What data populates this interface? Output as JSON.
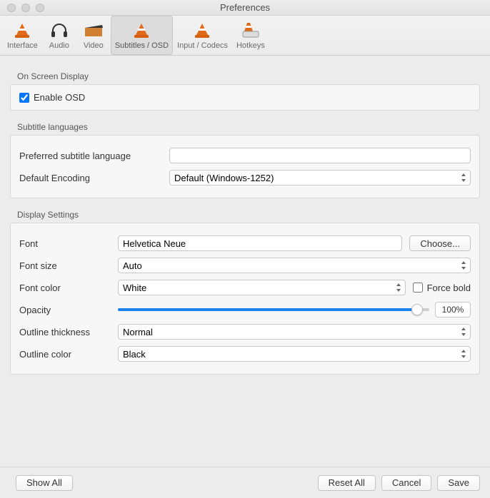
{
  "window": {
    "title": "Preferences"
  },
  "tabs": [
    {
      "label": "Interface"
    },
    {
      "label": "Audio"
    },
    {
      "label": "Video"
    },
    {
      "label": "Subtitles / OSD"
    },
    {
      "label": "Input / Codecs"
    },
    {
      "label": "Hotkeys"
    }
  ],
  "osd": {
    "section": "On Screen Display",
    "enable_label": "Enable OSD"
  },
  "subtitle_lang": {
    "section": "Subtitle languages",
    "preferred_label": "Preferred subtitle language",
    "preferred_value": "",
    "encoding_label": "Default Encoding",
    "encoding_value": "Default (Windows-1252)"
  },
  "display": {
    "section": "Display Settings",
    "font_label": "Font",
    "font_value": "Helvetica Neue",
    "choose_label": "Choose...",
    "font_size_label": "Font size",
    "font_size_value": "Auto",
    "font_color_label": "Font color",
    "font_color_value": "White",
    "force_bold_label": "Force bold",
    "opacity_label": "Opacity",
    "opacity_value": "100%",
    "outline_thickness_label": "Outline thickness",
    "outline_thickness_value": "Normal",
    "outline_color_label": "Outline color",
    "outline_color_value": "Black"
  },
  "footer": {
    "show_all": "Show All",
    "reset_all": "Reset All",
    "cancel": "Cancel",
    "save": "Save"
  }
}
